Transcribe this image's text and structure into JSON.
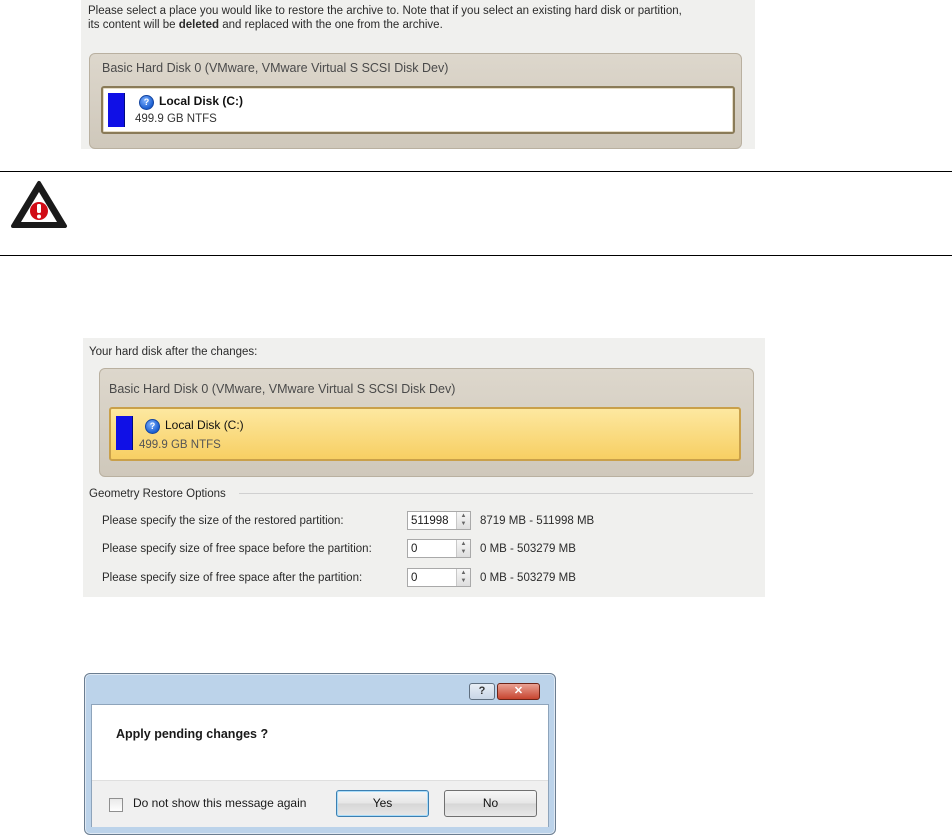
{
  "restore_location": {
    "instruction_part1": "Please select a place you would like to restore the archive to. Note that if you select an existing hard disk or partition,",
    "instruction_part2": "its content will be ",
    "instruction_bold": "deleted",
    "instruction_part3": " and replaced with the one from the archive.",
    "disk_title": "Basic Hard Disk 0 (VMware, VMware Virtual S SCSI Disk Dev)",
    "partition_name": "Local Disk (C:)",
    "partition_size": "499.9 GB NTFS"
  },
  "after_changes": {
    "heading": "Your hard disk after the changes:",
    "disk_title": "Basic Hard Disk 0 (VMware, VMware Virtual S SCSI Disk Dev)",
    "partition_name": "Local Disk (C:)",
    "partition_size": "499.9 GB NTFS",
    "geometry_group_label": "Geometry Restore Options",
    "options": [
      {
        "label": "Please specify the size of the restored partition:",
        "value": "511998",
        "range": "8719 MB - 511998 MB"
      },
      {
        "label": "Please specify size of free space before the partition:",
        "value": "0",
        "range": "0 MB - 503279 MB"
      },
      {
        "label": "Please specify size of free space after the partition:",
        "value": "0",
        "range": "0 MB - 503279 MB"
      }
    ]
  },
  "dialog": {
    "help_button": "?",
    "close_button": "✕",
    "message": "Apply pending changes ?",
    "checkbox_label": "Do not show this message again",
    "yes_label": "Yes",
    "no_label": "No"
  },
  "colors": {
    "partition_bar": "#1010e6",
    "warning_red": "#d10b16"
  },
  "icons": [
    "help-icon",
    "warning-icon",
    "close-icon",
    "checkbox"
  ]
}
